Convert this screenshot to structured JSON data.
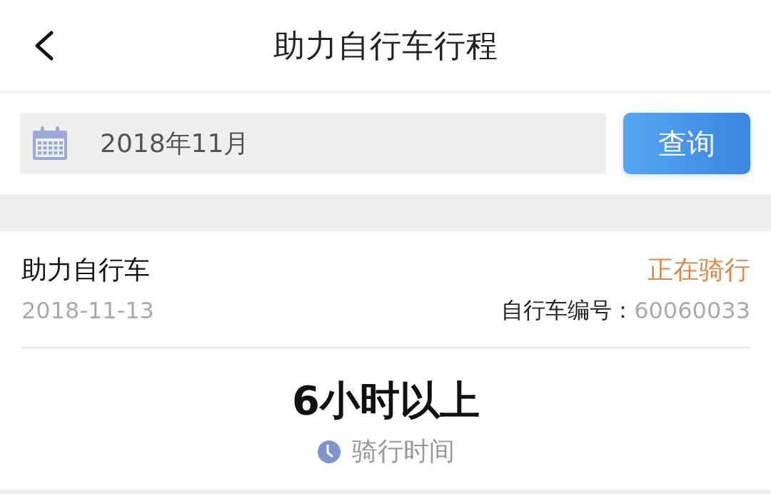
{
  "header": {
    "title": "助力自行车行程"
  },
  "search": {
    "value": "2018年11月",
    "button": "查询"
  },
  "trip": {
    "title": "助力自行车",
    "status": "正在骑行",
    "date": "2018-11-13",
    "bike_label": "自行车编号：",
    "bike_number": "60060033",
    "duration": "6小时以上",
    "duration_label": "骑行时间"
  }
}
